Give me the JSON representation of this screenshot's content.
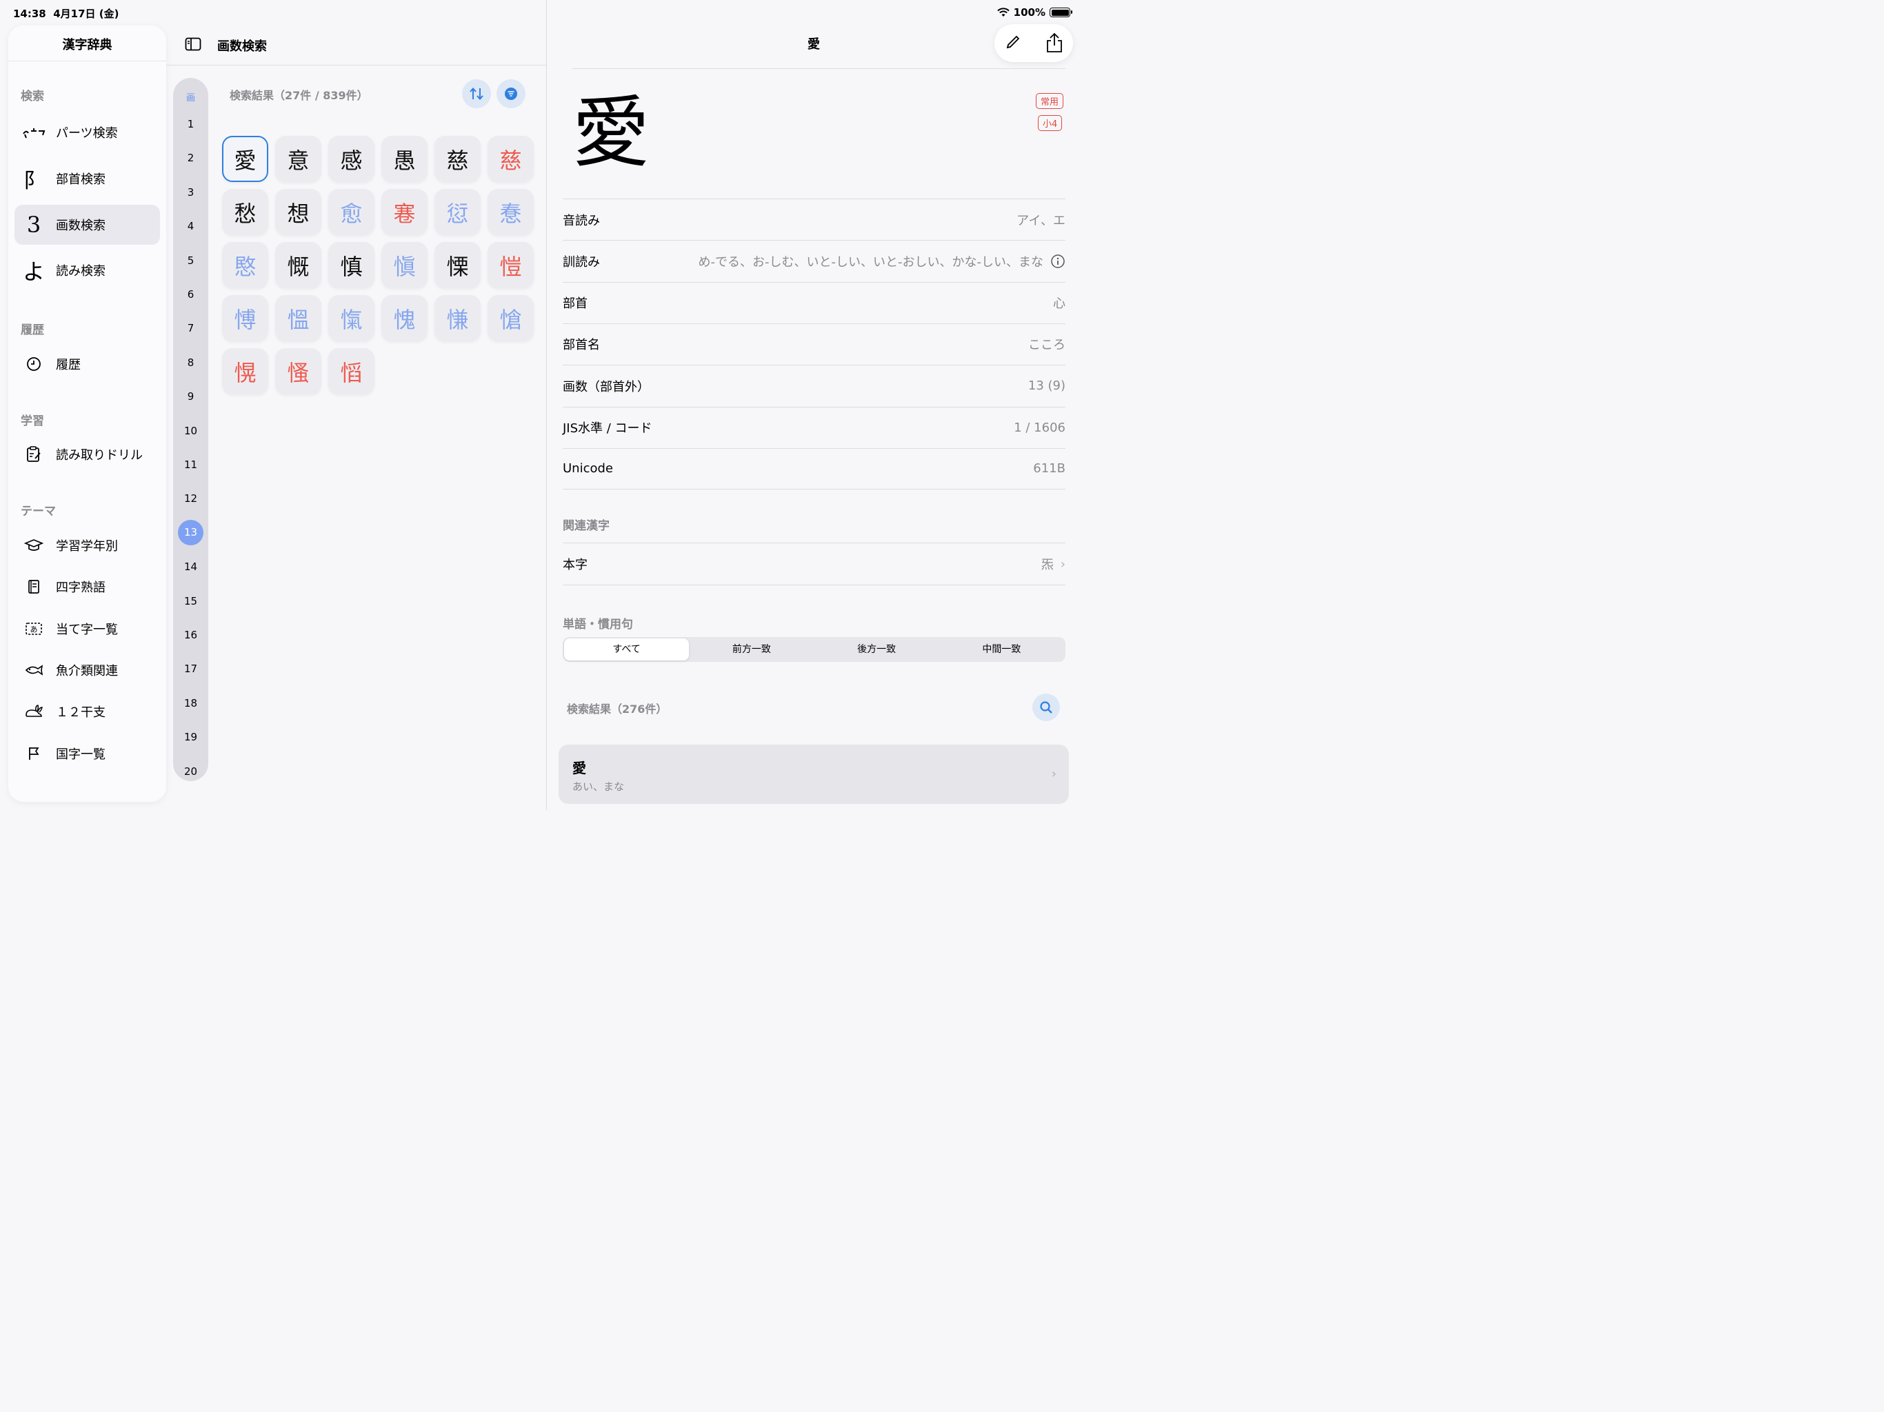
{
  "status": {
    "time": "14:38",
    "date": "4月17日 (金)",
    "battery": "100%"
  },
  "sidebar": {
    "title": "漢字辞典",
    "sections": {
      "search": "検索",
      "history": "履歴",
      "study": "学習",
      "theme": "テーマ"
    },
    "search_items": [
      "パーツ検索",
      "部首検索",
      "画数検索",
      "読み検索"
    ],
    "history_items": [
      "履歴"
    ],
    "study_items": [
      "読み取りドリル"
    ],
    "theme_items": [
      "学習学年別",
      "四字熟語",
      "当て字一覧",
      "魚介類関連",
      "１２干支",
      "国字一覧"
    ],
    "selected": "画数検索"
  },
  "middle": {
    "title": "画数検索",
    "index_header": "画",
    "strokes": [
      "1",
      "2",
      "3",
      "4",
      "5",
      "6",
      "7",
      "8",
      "9",
      "10",
      "11",
      "12",
      "13",
      "14",
      "15",
      "16",
      "17",
      "18",
      "19",
      "20"
    ],
    "selected_stroke": "13",
    "results_label": "検索結果（27件 / 839件）",
    "kanji": [
      {
        "k": "愛",
        "c": "black",
        "sel": true
      },
      {
        "k": "意",
        "c": "black"
      },
      {
        "k": "感",
        "c": "black"
      },
      {
        "k": "愚",
        "c": "black"
      },
      {
        "k": "慈",
        "c": "black"
      },
      {
        "k": "慈",
        "c": "red"
      },
      {
        "k": "愁",
        "c": "black"
      },
      {
        "k": "想",
        "c": "black"
      },
      {
        "k": "愈",
        "c": "blue"
      },
      {
        "k": "寋",
        "c": "red"
      },
      {
        "k": "愆",
        "c": "blue"
      },
      {
        "k": "惷",
        "c": "blue"
      },
      {
        "k": "愍",
        "c": "blue"
      },
      {
        "k": "慨",
        "c": "black"
      },
      {
        "k": "慎",
        "c": "black"
      },
      {
        "k": "愼",
        "c": "blue"
      },
      {
        "k": "慄",
        "c": "black"
      },
      {
        "k": "愷",
        "c": "red"
      },
      {
        "k": "愽",
        "c": "blue"
      },
      {
        "k": "慍",
        "c": "blue"
      },
      {
        "k": "愾",
        "c": "blue"
      },
      {
        "k": "愧",
        "c": "blue"
      },
      {
        "k": "慊",
        "c": "blue"
      },
      {
        "k": "愴",
        "c": "blue"
      },
      {
        "k": "愰",
        "c": "red"
      },
      {
        "k": "慅",
        "c": "red"
      },
      {
        "k": "慆",
        "c": "red"
      }
    ]
  },
  "detail": {
    "title": "愛",
    "kanji": "愛",
    "badges": [
      "常用",
      "小4"
    ],
    "rows": [
      {
        "k": "音読み",
        "v": "アイ、エ"
      },
      {
        "k": "訓読み",
        "v": "め-でる、お-しむ、いと-しい、いと-おしい、かな-しい、まな"
      },
      {
        "k": "部首",
        "v": "心"
      },
      {
        "k": "部首名",
        "v": "こころ"
      },
      {
        "k": "画数（部首外）",
        "v": "13 (9)"
      },
      {
        "k": "JIS水準 / コード",
        "v": "1 / 1606"
      },
      {
        "k": "Unicode",
        "v": "611B"
      }
    ],
    "related_title": "関連漢字",
    "related": {
      "k": "本字",
      "v": "炁"
    },
    "words_title": "単語・慣用句",
    "segments": [
      "すべて",
      "前方一致",
      "後方一致",
      "中間一致"
    ],
    "active_segment": "すべて",
    "words_results": "検索結果（276件）",
    "word": {
      "w": "愛",
      "r": "あい、まな"
    }
  }
}
